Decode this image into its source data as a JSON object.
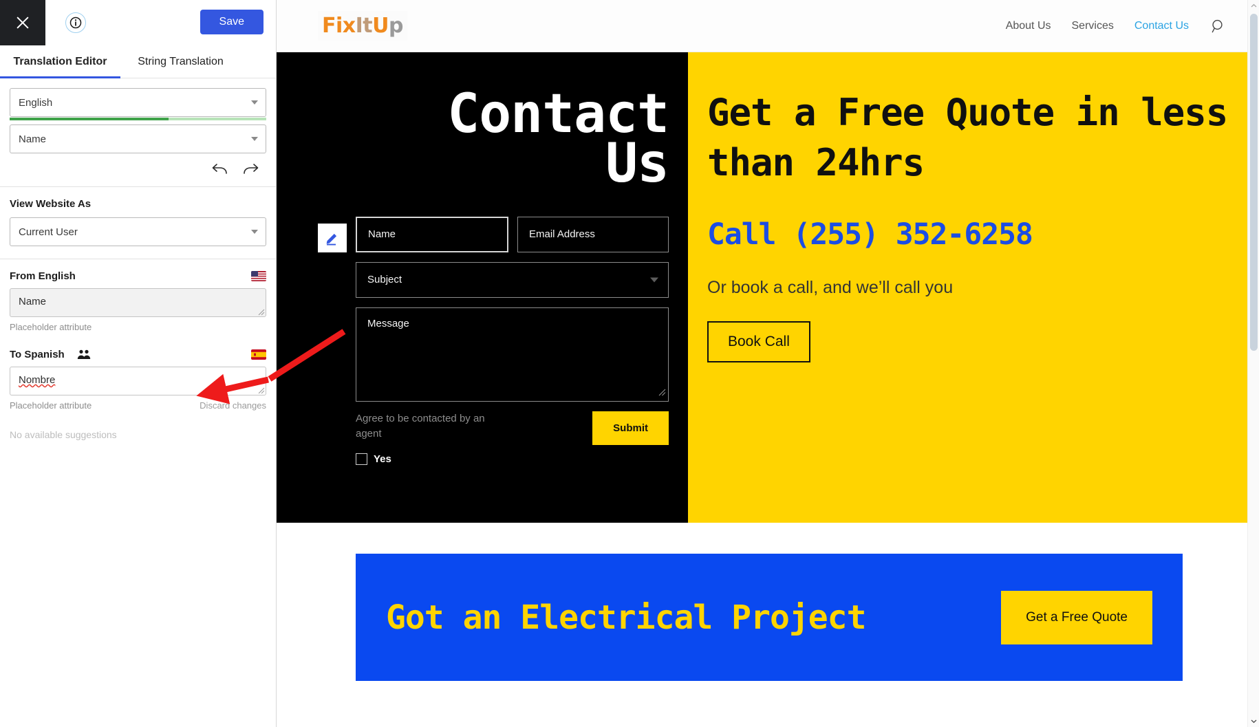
{
  "sidebar": {
    "close_icon": "close-icon",
    "info_icon": "info-icon",
    "save_label": "Save",
    "tabs": [
      {
        "label": "Translation Editor",
        "active": true
      },
      {
        "label": "String Translation",
        "active": false
      }
    ],
    "language_select": {
      "value": "English",
      "progress_percent": 62
    },
    "string_select": {
      "value": "Name"
    },
    "undo_icon": "undo-arrow-icon",
    "redo_icon": "redo-arrow-icon",
    "view_website_as": {
      "label": "View Website As",
      "value": "Current User"
    },
    "source": {
      "label": "From English",
      "flag": "us-flag-icon",
      "value": "Name",
      "meta": "Placeholder attribute"
    },
    "target": {
      "label": "To Spanish",
      "users_icon": "users-icon",
      "flag": "es-flag-icon",
      "value": "Nombre",
      "meta": "Placeholder attribute",
      "discard_label": "Discard changes"
    },
    "suggestions_empty": "No available suggestions"
  },
  "preview": {
    "header": {
      "logo": {
        "part1": "Fix",
        "part2": "It",
        "part3": "U",
        "part4": "p"
      },
      "nav": [
        {
          "label": "About Us",
          "active": false
        },
        {
          "label": "Services",
          "active": false
        },
        {
          "label": "Contact Us",
          "active": true
        }
      ],
      "search_icon": "search-icon"
    },
    "hero": {
      "title_line1": "Contact",
      "title_line2": "Us",
      "edit_icon": "pencil-edit-icon",
      "form": {
        "name_placeholder": "Name",
        "email_placeholder": "Email Address",
        "subject_placeholder": "Subject",
        "subject_caret": "chevron-down-icon",
        "message_placeholder": "Message",
        "consent_text": "Agree to be contacted by an agent",
        "checkbox_label": "Yes",
        "submit_label": "Submit"
      },
      "promo": {
        "headline": "Get a Free Quote in less than 24hrs",
        "phone": "Call (255) 352-6258",
        "subline": "Or book a call, and we’ll call you",
        "book_label": "Book Call"
      }
    },
    "banner": {
      "title": "Got an Electrical Project",
      "cta_label": "Get a Free Quote"
    },
    "scrollbar": {
      "up_icon": "chevron-up-icon",
      "down_icon": "chevron-down-icon"
    }
  },
  "colors": {
    "accent_blue": "#3457e0",
    "brand_yellow": "#ffd400",
    "banner_blue": "#0a49f0",
    "phone_blue": "#1b4de4",
    "nav_active": "#2aa3e3",
    "annotation_red": "#ee1b1b",
    "progress_green": "#3fa24a"
  }
}
